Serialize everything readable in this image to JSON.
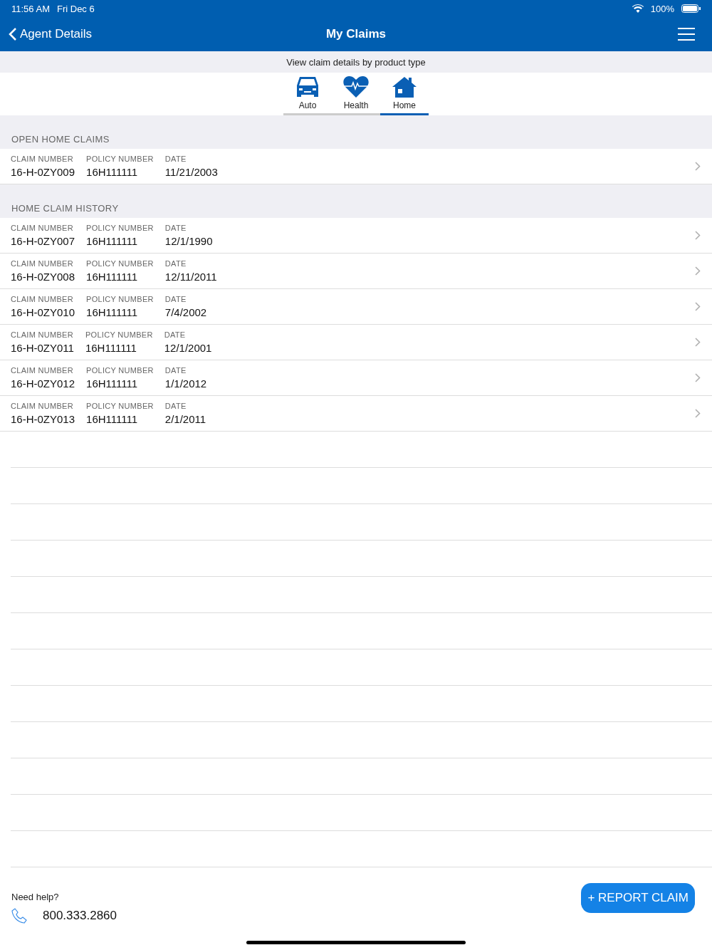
{
  "status_bar": {
    "time": "11:56 AM",
    "date": "Fri Dec 6",
    "battery": "100%"
  },
  "nav": {
    "back": "Agent Details",
    "title": "My Claims"
  },
  "subheader": "View claim details by product type",
  "tabs": [
    {
      "label": "Auto",
      "kind": "car",
      "selected": false
    },
    {
      "label": "Health",
      "kind": "heart",
      "selected": false
    },
    {
      "label": "Home",
      "kind": "house",
      "selected": true
    }
  ],
  "sections": [
    {
      "title": "OPEN HOME CLAIMS",
      "rows": [
        {
          "cells": [
            {
              "label": "CLAIM NUMBER",
              "value": "16-H-0ZY009"
            },
            {
              "label": "POLICY NUMBER",
              "value": "16H111111"
            },
            {
              "label": "DATE",
              "value": "11/21/2003"
            }
          ]
        }
      ]
    },
    {
      "title": "HOME CLAIM HISTORY",
      "rows": [
        {
          "cells": [
            {
              "label": "CLAIM NUMBER",
              "value": "16-H-0ZY007"
            },
            {
              "label": "POLICY NUMBER",
              "value": "16H111111"
            },
            {
              "label": "DATE",
              "value": "12/1/1990"
            }
          ]
        },
        {
          "cells": [
            {
              "label": "CLAIM NUMBER",
              "value": "16-H-0ZY008"
            },
            {
              "label": "POLICY NUMBER",
              "value": "16H111111"
            },
            {
              "label": "DATE",
              "value": "12/11/2011"
            }
          ]
        },
        {
          "cells": [
            {
              "label": "CLAIM NUMBER",
              "value": "16-H-0ZY010"
            },
            {
              "label": "POLICY NUMBER",
              "value": "16H111111"
            },
            {
              "label": "DATE",
              "value": "7/4/2002"
            }
          ]
        },
        {
          "cells": [
            {
              "label": "CLAIM NUMBER",
              "value": "16-H-0ZY011"
            },
            {
              "label": "POLICY NUMBER",
              "value": "16H111111"
            },
            {
              "label": "DATE",
              "value": "12/1/2001"
            }
          ]
        },
        {
          "cells": [
            {
              "label": "CLAIM NUMBER",
              "value": "16-H-0ZY012"
            },
            {
              "label": "POLICY NUMBER",
              "value": "16H111111"
            },
            {
              "label": "DATE",
              "value": "1/1/2012"
            }
          ]
        },
        {
          "cells": [
            {
              "label": "CLAIM NUMBER",
              "value": "16-H-0ZY013"
            },
            {
              "label": "POLICY NUMBER",
              "value": "16H111111"
            },
            {
              "label": "DATE",
              "value": "2/1/2011"
            }
          ]
        }
      ]
    }
  ],
  "footer": {
    "help": "Need help?",
    "phone": "800.333.2860",
    "button": "+ REPORT CLAIM"
  }
}
